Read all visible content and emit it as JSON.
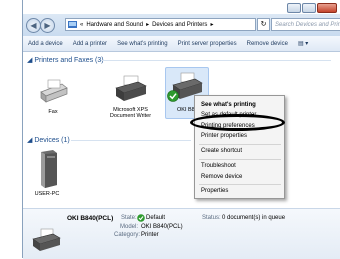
{
  "window": {
    "breadcrumb": [
      "«",
      "Hardware and Sound",
      "Devices and Printers"
    ],
    "search_placeholder": "Search Devices and Printers"
  },
  "toolbar": {
    "items": [
      "Add a device",
      "Add a printer",
      "See what's printing",
      "Print server properties",
      "Remove device"
    ]
  },
  "printers_group": {
    "label": "Printers and Faxes (3)",
    "devices": [
      "Fax",
      "Microsoft XPS Document Writer",
      "OKI B840"
    ]
  },
  "devices_group": {
    "label": "Devices (1)",
    "devices": [
      "USER-PC"
    ]
  },
  "context_menu": {
    "items": [
      "See what's printing",
      "Set as default printer",
      "Printing preferences",
      "Printer properties",
      "Create shortcut",
      "Troubleshoot",
      "Remove device",
      "Properties"
    ]
  },
  "details": {
    "name": "OKI B840(PCL)",
    "state_label": "State:",
    "state_value": "Default",
    "status_label": "Status:",
    "status_value": "0 document(s) in queue",
    "model_label": "Model:",
    "model_value": "OKI B840(PCL)",
    "category_label": "Category:",
    "category_value": "Printer"
  }
}
